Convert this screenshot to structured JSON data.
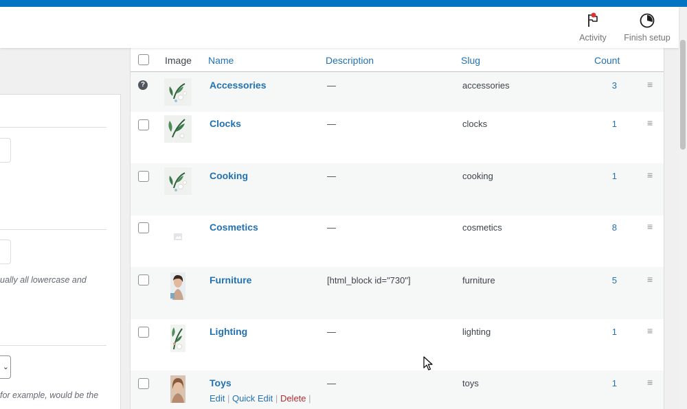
{
  "header": {
    "activity_label": "Activity",
    "finish_setup_label": "Finish setup",
    "accent_blue": "#0074c2",
    "notify_dot_color": "#d63638"
  },
  "form": {
    "slug_help_fragment": "ually all lowercase and",
    "parent_help_fragment": "for example, would be the"
  },
  "table": {
    "columns": [
      "Image",
      "Name",
      "Description",
      "Slug",
      "Count"
    ],
    "rows": [
      {
        "name": "Accessories",
        "description": "—",
        "slug": "accessories",
        "count": "3",
        "image": "leaf-thumbnail"
      },
      {
        "name": "Clocks",
        "description": "—",
        "slug": "clocks",
        "count": "1",
        "image": "leaf-thumbnail"
      },
      {
        "name": "Cooking",
        "description": "—",
        "slug": "cooking",
        "count": "1",
        "image": "leaf-thumbnail"
      },
      {
        "name": "Cosmetics",
        "description": "—",
        "slug": "cosmetics",
        "count": "8",
        "image": "placeholder-thumbnail"
      },
      {
        "name": "Furniture",
        "description": "[html_block id=\"730\"]",
        "slug": "furniture",
        "count": "5",
        "image": "portrait-thumbnail"
      },
      {
        "name": "Lighting",
        "description": "—",
        "slug": "lighting",
        "count": "1",
        "image": "leaf-thumbnail"
      },
      {
        "name": "Toys",
        "description": "—",
        "slug": "toys",
        "count": "1",
        "image": "portrait-thumbnail"
      }
    ],
    "row_actions": {
      "edit": "Edit",
      "quick_edit": "Quick Edit",
      "delete": "Delete",
      "separator": "|"
    }
  }
}
